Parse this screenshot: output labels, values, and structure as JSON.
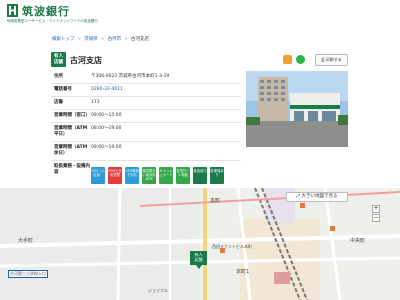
{
  "header": {
    "logo_text": "筑波銀行",
    "logo_sub": "地域密着型ユーザービス・ワイドネットワークの筑波銀行"
  },
  "breadcrumb": [
    "検索トップ",
    "茨城県",
    "古河市",
    "古河支店"
  ],
  "branch": {
    "badge": "有人\n店舗",
    "title": "古河支店"
  },
  "actions": {
    "print_label": "印刷する"
  },
  "info_rows": [
    {
      "key": "住所",
      "value": "〒306-0023 茨城県古河市本町1-3-19"
    },
    {
      "key": "電話番号",
      "value": "0280-32-4611"
    },
    {
      "key": "店番",
      "value": "173"
    },
    {
      "key": "営業時間（窓口）",
      "value": "09:00～15:00"
    },
    {
      "key": "営業時間（ATM平日）",
      "value": "08:00～19:00"
    },
    {
      "key": "営業時間（ATM休日）",
      "value": "09:00～19:00"
    },
    {
      "key": "取扱業務・設備内容",
      "value": ""
    }
  ],
  "service_chips": [
    {
      "label": "ATM（入出金）",
      "color": "#2e9ad6"
    },
    {
      "label": "ATM土日祝営業",
      "color": "#e23c3c"
    },
    {
      "label": "ATM車椅子対応",
      "color": "#2e9ad6"
    },
    {
      "label": "視覚障がい者対応ATM",
      "color": "#36a84a"
    },
    {
      "label": "キャッシュカード",
      "color": "#36a84a"
    },
    {
      "label": "住宅ローン相談",
      "color": "#36a84a"
    },
    {
      "label": "投信窓口",
      "color": "#1b7a4a"
    },
    {
      "label": "駐車場あり",
      "color": "#1b7a4a"
    }
  ],
  "map": {
    "expand_button": "大きい地図で見る",
    "marker_label": "有人\n店舗",
    "labels": [
      "本町",
      "本町1",
      "大手町",
      "中央町",
      "古河第三小学校入口",
      "西田テナントビル本町",
      "ジョイフル"
    ]
  }
}
